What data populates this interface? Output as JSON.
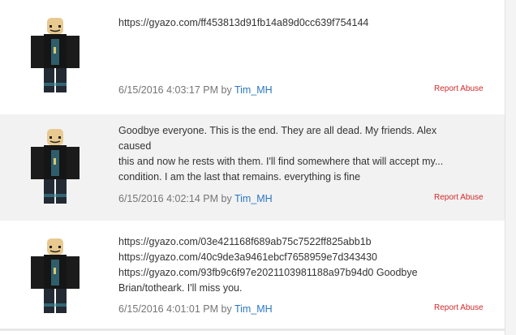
{
  "comments": [
    {
      "text": "https://gyazo.com/ff453813d91fb14a89d0cc639f754144",
      "date": "6/15/2016 4:03:17 PM",
      "by": "by",
      "author": "Tim_MH",
      "report": "Report Abuse"
    },
    {
      "text": "Goodbye everyone. This is the end. They are all dead. My friends. Alex caused\nthis and now he rests with them. I'll find somewhere that will accept my...\ncondition. I am the last that remains. everything is fine",
      "date": "6/15/2016 4:02:14 PM",
      "by": "by",
      "author": "Tim_MH",
      "report": "Report Abuse"
    },
    {
      "text": "https://gyazo.com/03e421168f689ab75c7522ff825abb1b\nhttps://gyazo.com/40c9de3a9461ebcf7658959e7d343430\nhttps://gyazo.com/93fb9c6f97e2021103981188a97b94d0 Goodbye\nBrian/totheark. I'll miss you.",
      "date": "6/15/2016 4:01:01 PM",
      "by": "by",
      "author": "Tim_MH",
      "report": "Report Abuse"
    }
  ]
}
